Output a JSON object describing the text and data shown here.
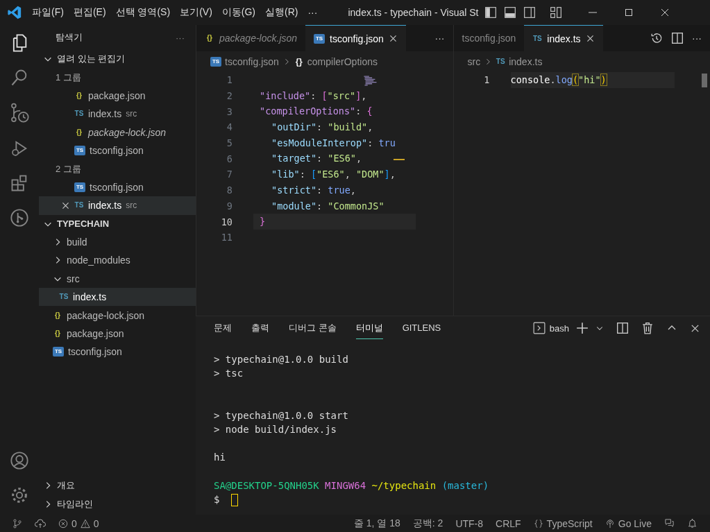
{
  "title_bar": {
    "menus": [
      "파일(F)",
      "편집(E)",
      "선택 영역(S)",
      "보기(V)",
      "이동(G)",
      "실행(R)",
      "···"
    ],
    "title": "index.ts - typechain - Visual St"
  },
  "sidebar": {
    "title": "탐색기",
    "more": "···",
    "open_editors": {
      "label": "열려 있는 편집기",
      "expanded": true,
      "groups": [
        {
          "label": "1 그룹",
          "files": [
            {
              "name": "package.json",
              "badge": "{}",
              "kind": "json",
              "preview": false,
              "selected": false
            },
            {
              "name": "index.ts",
              "badge": "TS",
              "kind": "ts",
              "detail": "src",
              "preview": false,
              "selected": false
            },
            {
              "name": "package-lock.json",
              "badge": "{}",
              "kind": "json",
              "preview": true,
              "selected": false
            },
            {
              "name": "tsconfig.json",
              "badge": "TS",
              "kind": "tsconfig",
              "preview": false,
              "selected": false
            }
          ]
        },
        {
          "label": "2 그룹",
          "files": [
            {
              "name": "tsconfig.json",
              "badge": "TS",
              "kind": "tsconfig",
              "preview": false,
              "selected": false
            },
            {
              "name": "index.ts",
              "badge": "TS",
              "kind": "ts",
              "detail": "src",
              "preview": false,
              "selected": true
            }
          ]
        }
      ]
    },
    "explorer": {
      "label": "TYPECHAIN",
      "expanded": true,
      "children": [
        {
          "name": "build",
          "kind": "folder",
          "expanded": false
        },
        {
          "name": "node_modules",
          "kind": "folder",
          "expanded": false
        },
        {
          "name": "src",
          "kind": "folder",
          "expanded": true,
          "children": [
            {
              "name": "index.ts",
              "kind": "ts",
              "badge": "TS",
              "selected": true
            }
          ]
        },
        {
          "name": "package-lock.json",
          "kind": "json",
          "badge": "{}",
          "selected": false
        },
        {
          "name": "package.json",
          "kind": "json",
          "badge": "{}",
          "selected": false
        },
        {
          "name": "tsconfig.json",
          "kind": "tsconfig",
          "badge": "TS",
          "selected": false
        }
      ]
    },
    "bottom_sections": [
      {
        "label": "개요",
        "expanded": false
      },
      {
        "label": "타임라인",
        "expanded": false
      }
    ]
  },
  "editors": [
    {
      "tabs": [
        {
          "label": "package-lock.json",
          "kind": "json",
          "badge": "{}",
          "selected": false,
          "preview": true
        },
        {
          "label": "tsconfig.json",
          "kind": "tsconfig",
          "badge": "TS",
          "selected": true,
          "preview": false
        }
      ],
      "more": "···",
      "breadcrumbs": [
        {
          "text": "tsconfig.json",
          "kind": "tsconfig",
          "badge": "TS"
        },
        {
          "text": "compilerOptions",
          "kind": "object",
          "badge": "{}"
        }
      ],
      "lines": [
        {
          "number": "1",
          "current": false
        },
        {
          "number": "2",
          "current": false,
          "nested": false,
          "tokens": [
            {
              "t": "\"include\"",
              "kind": "key"
            },
            {
              "t": ": ",
              "kind": "p"
            },
            {
              "t": "[",
              "kind": "b2"
            },
            {
              "t": "\"src\"",
              "kind": "str"
            },
            {
              "t": "]",
              "kind": "b2"
            },
            {
              "t": ",",
              "kind": "p"
            }
          ]
        },
        {
          "number": "3",
          "current": false,
          "nested": false,
          "tokens": [
            {
              "t": "\"compilerOptions\"",
              "kind": "key"
            },
            {
              "t": ": ",
              "kind": "p"
            },
            {
              "t": "{",
              "kind": "b2"
            }
          ]
        },
        {
          "number": "4",
          "current": false,
          "nested": true,
          "tokens": [
            {
              "t": "\"outDir\"",
              "kind": "key2"
            },
            {
              "t": ": ",
              "kind": "p"
            },
            {
              "t": "\"build\"",
              "kind": "str"
            },
            {
              "t": ",",
              "kind": "p"
            }
          ]
        },
        {
          "number": "5",
          "current": false,
          "nested": true,
          "tokens": [
            {
              "t": "\"esModuleInterop\"",
              "kind": "key2"
            },
            {
              "t": ": ",
              "kind": "p"
            },
            {
              "t": "tru",
              "kind": "bool"
            }
          ]
        },
        {
          "number": "6",
          "current": false,
          "nested": true,
          "tokens": [
            {
              "t": "\"target\"",
              "kind": "key2"
            },
            {
              "t": ": ",
              "kind": "p"
            },
            {
              "t": "\"ES6\"",
              "kind": "str"
            },
            {
              "t": ",",
              "kind": "p"
            }
          ]
        },
        {
          "number": "7",
          "current": false,
          "nested": true,
          "tokens": [
            {
              "t": "\"lib\"",
              "kind": "key2"
            },
            {
              "t": ": ",
              "kind": "p"
            },
            {
              "t": "[",
              "kind": "b3"
            },
            {
              "t": "\"ES6\"",
              "kind": "str"
            },
            {
              "t": ", ",
              "kind": "p"
            },
            {
              "t": "\"DOM\"",
              "kind": "str"
            },
            {
              "t": "]",
              "kind": "b3"
            },
            {
              "t": ",",
              "kind": "p"
            }
          ]
        },
        {
          "number": "8",
          "current": false,
          "nested": true,
          "tokens": [
            {
              "t": "\"strict\"",
              "kind": "key2"
            },
            {
              "t": ": ",
              "kind": "p"
            },
            {
              "t": "true",
              "kind": "bool"
            },
            {
              "t": ",",
              "kind": "p"
            }
          ]
        },
        {
          "number": "9",
          "current": false,
          "nested": true,
          "tokens": [
            {
              "t": "\"module\"",
              "kind": "key2"
            },
            {
              "t": ": ",
              "kind": "p"
            },
            {
              "t": "\"CommonJS\"",
              "kind": "str"
            }
          ]
        },
        {
          "number": "10",
          "current": true,
          "nested": false,
          "tokens": [
            {
              "t": "}",
              "kind": "b2"
            }
          ]
        },
        {
          "number": "11",
          "current": false
        }
      ]
    },
    {
      "tabs": [
        {
          "label": "tsconfig.json",
          "selected": false,
          "preview": false
        },
        {
          "label": "index.ts",
          "kind": "ts",
          "badge": "TS",
          "selected": true,
          "preview": false
        }
      ],
      "more": "···",
      "breadcrumbs": [
        {
          "text": "src"
        },
        {
          "text": "index.ts",
          "kind": "ts",
          "badge": "TS"
        }
      ],
      "lines": [
        {
          "number": "1",
          "current": true,
          "tokens": [
            {
              "t": "console",
              "kind": "id"
            },
            {
              "t": ".",
              "kind": "p"
            },
            {
              "t": "log",
              "kind": "fn"
            },
            {
              "t": "(",
              "kind": "match"
            },
            {
              "t": "\"hi\"",
              "kind": "str"
            },
            {
              "t": ")",
              "kind": "match"
            }
          ]
        }
      ]
    }
  ],
  "panel": {
    "tabs": [
      {
        "label": "문제",
        "selected": false
      },
      {
        "label": "출력",
        "selected": false
      },
      {
        "label": "디버그 콘솔",
        "selected": false
      },
      {
        "label": "터미널",
        "selected": true
      },
      {
        "label": "GITLENS",
        "selected": false
      }
    ],
    "shell": "bash",
    "terminal": [
      {
        "kind": "output",
        "text": "> typechain@1.0.0 build"
      },
      {
        "kind": "output",
        "text": "> tsc"
      },
      {
        "kind": "blank"
      },
      {
        "kind": "blank"
      },
      {
        "kind": "output",
        "text": "> typechain@1.0.0 start"
      },
      {
        "kind": "output",
        "text": "> node build/index.js"
      },
      {
        "kind": "blank"
      },
      {
        "kind": "output",
        "text": "hi"
      },
      {
        "kind": "blank"
      },
      {
        "kind": "prompt",
        "segments": [
          {
            "text": "SA@DESKTOP-5QNH05K",
            "color": "#23d18b"
          },
          {
            "text": "MINGW64",
            "color": "#d670d6"
          },
          {
            "text": "~/typechain",
            "color": "#e5e510"
          },
          {
            "text": "(master)",
            "color": "#29b8db"
          }
        ]
      },
      {
        "kind": "input",
        "text": "$"
      }
    ]
  },
  "status_bar": {
    "errors": "0",
    "warnings": "0",
    "items": [
      "줄 1, 열 18",
      "공백: 2",
      "UTF-8",
      "CRLF"
    ],
    "language": "TypeScript",
    "live": "Go Live"
  }
}
